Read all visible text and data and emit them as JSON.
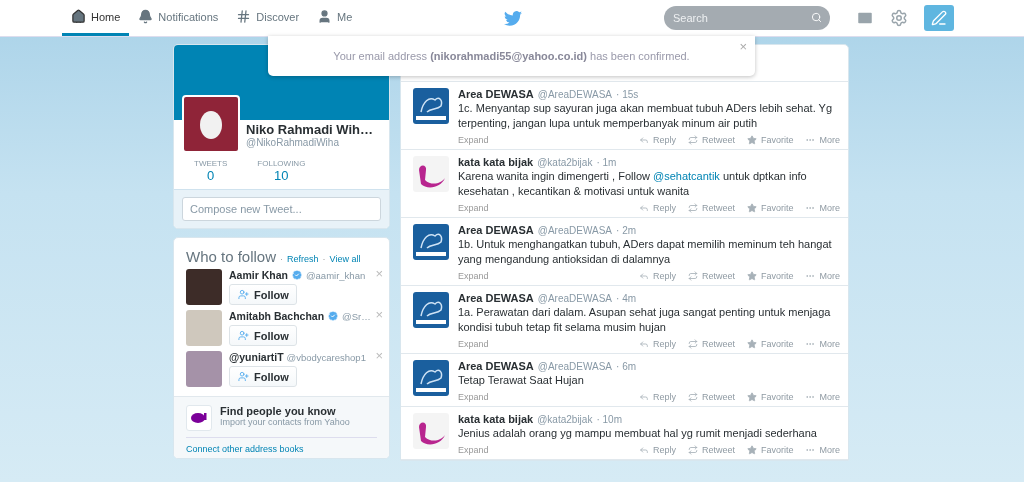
{
  "nav": {
    "tabs": [
      {
        "label": "Home",
        "selected": true
      },
      {
        "label": "Notifications",
        "selected": false
      },
      {
        "label": "Discover",
        "selected": false
      },
      {
        "label": "Me",
        "selected": false
      }
    ],
    "search": {
      "placeholder": "Search"
    }
  },
  "notice": {
    "text": "Your email address **(nikorahmadi55@yahoo.co.id)** has been confirmed.",
    "close": "×"
  },
  "profile": {
    "name": "Niko Rahmadi Wih…",
    "handle": "@NikoRahmadiWiha",
    "stats": [
      {
        "label": "TWEETS",
        "value": "0"
      },
      {
        "label": "FOLLOWING",
        "value": "10"
      }
    ],
    "compose": {
      "placeholder": "Compose new Tweet..."
    }
  },
  "who_to_follow": {
    "title": "Who to follow",
    "links": [
      {
        "separator": "·",
        "label": "Refresh"
      },
      {
        "separator": "·",
        "label": "View all"
      }
    ],
    "suggestions": [
      {
        "name": "Aamir Khan",
        "verified": true,
        "handle": "@aamir_khan",
        "button": "Follow",
        "close": "×"
      },
      {
        "name": "Amitabh Bachchan",
        "verified": true,
        "handle": "@Sr…",
        "button": "Follow",
        "close": "×"
      },
      {
        "name": "@yuniartiT",
        "verified": false,
        "handle": "@vbodycareshop1",
        "button": "Follow",
        "close": "×"
      }
    ]
  },
  "find_people": {
    "title": "Find people you know",
    "subtitle": "Import your contacts from Yahoo",
    "link": "Connect other address books"
  },
  "tweets": [
    {
      "name": "Area DEWASA",
      "handle": "@AreaDEWASA",
      "time": "· 15s",
      "kind": "figure",
      "segments": [
        {
          "kind": "plain",
          "text": "1c. Menyantap sup sayuran juga akan membuat tubuh ADers lebih sehat. Yg terpenting, jangan lupa untuk memperbanyak minum air putih"
        }
      ],
      "expand": "Expand",
      "actions": [
        "Reply",
        "Retweet",
        "Favorite",
        "More"
      ]
    },
    {
      "name": "kata kata bijak",
      "handle": "@kata2bijak",
      "time": "· 1m",
      "kind": "swan",
      "segments": [
        {
          "kind": "plain",
          "text": "Karena  wanita ingin dimengerti , Follow "
        },
        {
          "kind": "mention",
          "text": "@sehatcantik"
        },
        {
          "kind": "plain",
          "text": " untuk dptkan info kesehatan , kecantikan  &  motivasi untuk wanita"
        }
      ],
      "expand": "Expand",
      "actions": [
        "Reply",
        "Retweet",
        "Favorite",
        "More"
      ]
    },
    {
      "name": "Area DEWASA",
      "handle": "@AreaDEWASA",
      "time": "· 2m",
      "kind": "figure",
      "segments": [
        {
          "kind": "plain",
          "text": "1b. Untuk menghangatkan tubuh, ADers dapat memilih meminum teh hangat yang mengandung antioksidan di dalamnya"
        }
      ],
      "expand": "Expand",
      "actions": [
        "Reply",
        "Retweet",
        "Favorite",
        "More"
      ]
    },
    {
      "name": "Area DEWASA",
      "handle": "@AreaDEWASA",
      "time": "· 4m",
      "kind": "figure",
      "segments": [
        {
          "kind": "plain",
          "text": "1a. Perawatan dari dalam. Asupan sehat juga sangat penting untuk menjaga kondisi tubuh tetap fit selama musim hujan"
        }
      ],
      "expand": "Expand",
      "actions": [
        "Reply",
        "Retweet",
        "Favorite",
        "More"
      ]
    },
    {
      "name": "Area DEWASA",
      "handle": "@AreaDEWASA",
      "time": "· 6m",
      "kind": "figure",
      "segments": [
        {
          "kind": "plain",
          "text": "Tetap Terawat Saat Hujan"
        }
      ],
      "expand": "Expand",
      "actions": [
        "Reply",
        "Retweet",
        "Favorite",
        "More"
      ]
    },
    {
      "name": "kata kata bijak",
      "handle": "@kata2bijak",
      "time": "· 10m",
      "kind": "swan",
      "segments": [
        {
          "kind": "plain",
          "text": "Jenius adalah orang yg mampu membuat hal yg rumit menjadi sederhana"
        }
      ],
      "expand": "Expand",
      "actions": [
        "Reply",
        "Retweet",
        "Favorite",
        "More"
      ]
    }
  ]
}
